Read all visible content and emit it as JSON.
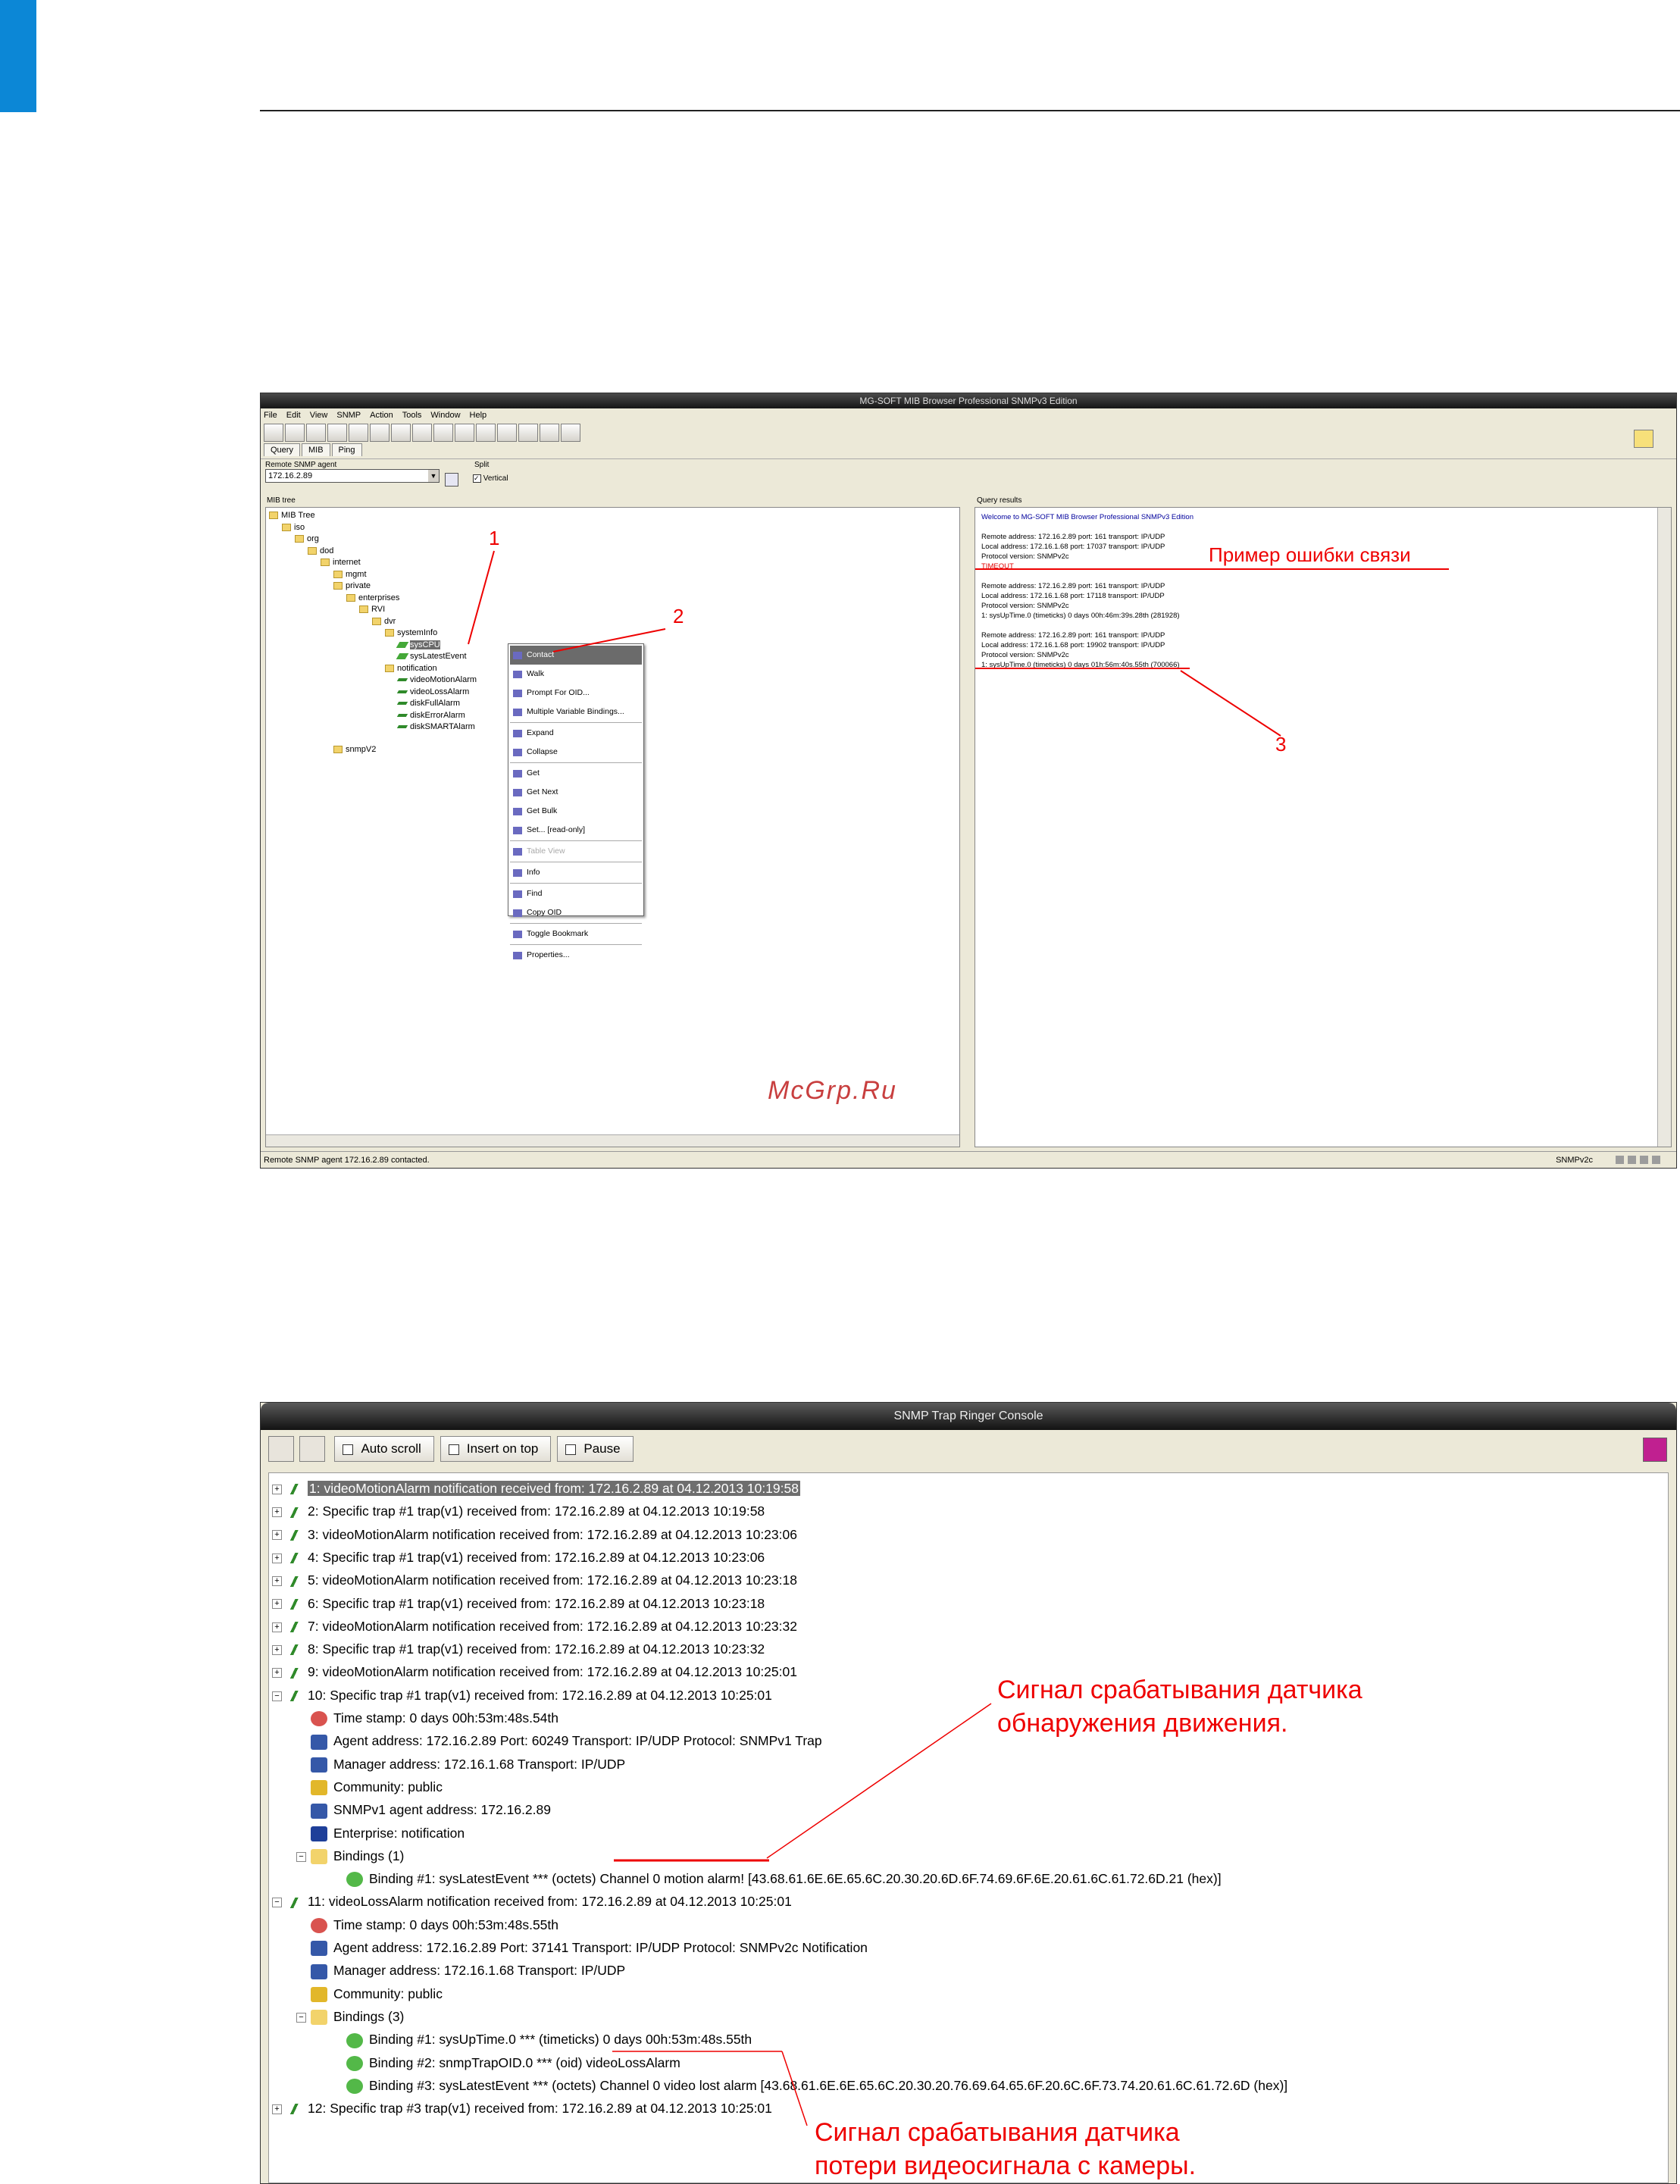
{
  "window1": {
    "title": "MG-SOFT MIB Browser Professional SNMPv3 Edition",
    "menu": [
      "File",
      "Edit",
      "View",
      "SNMP",
      "Action",
      "Tools",
      "Window",
      "Help"
    ],
    "tabs": [
      "Query",
      "MIB",
      "Ping"
    ],
    "agent_label": "Remote SNMP agent",
    "agent_value": "172.16.2.89",
    "split_label": "Split",
    "vertical_label": "Vertical",
    "mib_tree_label": "MIB tree",
    "query_results_label": "Query results",
    "tree": [
      {
        "text": "MIB Tree",
        "level": 0,
        "icon": "folder"
      },
      {
        "text": "iso",
        "level": 1,
        "icon": "folder"
      },
      {
        "text": "org",
        "level": 2,
        "icon": "folder"
      },
      {
        "text": "dod",
        "level": 3,
        "icon": "folder"
      },
      {
        "text": "internet",
        "level": 4,
        "icon": "folder"
      },
      {
        "text": "mgmt",
        "level": 5,
        "icon": "folder"
      },
      {
        "text": "private",
        "level": 5,
        "icon": "folder"
      },
      {
        "text": "enterprises",
        "level": 6,
        "icon": "folder"
      },
      {
        "text": "RVI",
        "level": 7,
        "icon": "folder"
      },
      {
        "text": "dvr",
        "level": 8,
        "icon": "folder"
      },
      {
        "text": "systemInfo",
        "level": 9,
        "icon": "folder"
      },
      {
        "text": "sysCPU",
        "level": 10,
        "icon": "leaf",
        "selected": true
      },
      {
        "text": "sysLatestEvent",
        "level": 10,
        "icon": "leaf"
      },
      {
        "text": "notification",
        "level": 9,
        "icon": "folder"
      },
      {
        "text": "videoMotionAlarm",
        "level": 10,
        "icon": "trap"
      },
      {
        "text": "videoLossAlarm",
        "level": 10,
        "icon": "trap"
      },
      {
        "text": "diskFullAlarm",
        "level": 10,
        "icon": "trap"
      },
      {
        "text": "diskErrorAlarm",
        "level": 10,
        "icon": "trap"
      },
      {
        "text": "diskSMARTAlarm",
        "level": 10,
        "icon": "trap"
      },
      {
        "text": "snmpV2",
        "level": 5,
        "icon": "folder"
      }
    ],
    "context_menu": [
      {
        "label": "Contact",
        "highlight": true
      },
      {
        "label": "Walk"
      },
      {
        "label": "Prompt For OID..."
      },
      {
        "label": "Multiple Variable Bindings..."
      },
      {
        "sep": true
      },
      {
        "label": "Expand"
      },
      {
        "label": "Collapse"
      },
      {
        "sep": true
      },
      {
        "label": "Get"
      },
      {
        "label": "Get Next"
      },
      {
        "label": "Get Bulk"
      },
      {
        "label": "Set... [read-only]"
      },
      {
        "sep": true
      },
      {
        "label": "Table View",
        "disabled": true
      },
      {
        "sep": true
      },
      {
        "label": "Info"
      },
      {
        "sep": true
      },
      {
        "label": "Find"
      },
      {
        "label": "Copy OID"
      },
      {
        "sep": true
      },
      {
        "label": "Toggle Bookmark"
      },
      {
        "sep": true
      },
      {
        "label": "Properties..."
      }
    ],
    "query_results": [
      {
        "text": "Welcome to MG-SOFT MIB Browser Professional SNMPv3 Edition",
        "style": "blue"
      },
      {
        "text": "",
        "style": ""
      },
      {
        "text": "Remote address: 172.16.2.89  port: 161 transport: IP/UDP",
        "style": ""
      },
      {
        "text": "Local address: 172.16.1.68  port: 17037 transport: IP/UDP",
        "style": ""
      },
      {
        "text": "Protocol version: SNMPv2c",
        "style": ""
      },
      {
        "text": "TIMEOUT",
        "style": "red"
      },
      {
        "text": "",
        "style": ""
      },
      {
        "text": "Remote address: 172.16.2.89  port: 161 transport: IP/UDP",
        "style": ""
      },
      {
        "text": "Local address: 172.16.1.68  port: 17118 transport: IP/UDP",
        "style": ""
      },
      {
        "text": "Protocol version: SNMPv2c",
        "style": ""
      },
      {
        "text": "1: sysUpTime.0 (timeticks) 0 days 00h:46m:39s.28th (281928)",
        "style": ""
      },
      {
        "text": "",
        "style": ""
      },
      {
        "text": "Remote address: 172.16.2.89  port: 161 transport: IP/UDP",
        "style": ""
      },
      {
        "text": "Local address: 172.16.1.68  port: 19902 transport: IP/UDP",
        "style": ""
      },
      {
        "text": "Protocol version: SNMPv2c",
        "style": ""
      },
      {
        "text": "1: sysUpTime.0 (timeticks) 0 days 01h:56m:40s.55th (700066)",
        "style": ""
      }
    ],
    "status_left": "Remote SNMP agent 172.16.2.89 contacted.",
    "status_right": "SNMPv2c"
  },
  "annotations1": {
    "label1": "1",
    "label2": "2",
    "label3": "3",
    "error_example": "Пример ошибки связи",
    "watermark": "McGrp.Ru"
  },
  "window2": {
    "title": "SNMP Trap Ringer Console",
    "checkboxes": [
      "Auto scroll",
      "Insert on top",
      "Pause"
    ],
    "rows": [
      {
        "text": "1: videoMotionAlarm notification received from: 172.16.2.89 at 04.12.2013 10:19:58",
        "indent": 0,
        "icon": "trap",
        "pm": "+",
        "selected": true
      },
      {
        "text": "2: Specific trap #1 trap(v1) received from: 172.16.2.89 at 04.12.2013 10:19:58",
        "indent": 0,
        "icon": "trap",
        "pm": "+"
      },
      {
        "text": "3: videoMotionAlarm notification received from: 172.16.2.89 at 04.12.2013 10:23:06",
        "indent": 0,
        "icon": "trap",
        "pm": "+"
      },
      {
        "text": "4: Specific trap #1 trap(v1) received from: 172.16.2.89 at 04.12.2013 10:23:06",
        "indent": 0,
        "icon": "trap",
        "pm": "+"
      },
      {
        "text": "5: videoMotionAlarm notification received from: 172.16.2.89 at 04.12.2013 10:23:18",
        "indent": 0,
        "icon": "trap",
        "pm": "+"
      },
      {
        "text": "6: Specific trap #1 trap(v1) received from: 172.16.2.89 at 04.12.2013 10:23:18",
        "indent": 0,
        "icon": "trap",
        "pm": "+"
      },
      {
        "text": "7: videoMotionAlarm notification received from: 172.16.2.89 at 04.12.2013 10:23:32",
        "indent": 0,
        "icon": "trap",
        "pm": "+"
      },
      {
        "text": "8: Specific trap #1 trap(v1) received from: 172.16.2.89 at 04.12.2013 10:23:32",
        "indent": 0,
        "icon": "trap",
        "pm": "+"
      },
      {
        "text": "9: videoMotionAlarm notification received from: 172.16.2.89 at 04.12.2013 10:25:01",
        "indent": 0,
        "icon": "trap",
        "pm": "+"
      },
      {
        "text": "10: Specific trap #1 trap(v1) received from: 172.16.2.89 at 04.12.2013 10:25:01",
        "indent": 0,
        "icon": "trap",
        "pm": "-"
      },
      {
        "text": "Time stamp: 0 days 00h:53m:48s.54th",
        "indent": 1,
        "icon": "clock"
      },
      {
        "text": "Agent address: 172.16.2.89 Port: 60249 Transport: IP/UDP Protocol: SNMPv1 Trap",
        "indent": 1,
        "icon": "pc"
      },
      {
        "text": "Manager address: 172.16.1.68 Transport: IP/UDP",
        "indent": 1,
        "icon": "pc"
      },
      {
        "text": "Community: public",
        "indent": 1,
        "icon": "key"
      },
      {
        "text": "SNMPv1 agent address: 172.16.2.89",
        "indent": 1,
        "icon": "pc"
      },
      {
        "text": "Enterprise: notification",
        "indent": 1,
        "icon": "chart"
      },
      {
        "text": "Bindings (1)",
        "indent": 1,
        "icon": "folder",
        "pm": "-"
      },
      {
        "text": "Binding #1: sysLatestEvent *** (octets) Channel 0 motion alarm! [43.68.61.6E.6E.65.6C.20.30.20.6D.6F.74.69.6F.6E.20.61.6C.61.72.6D.21 (hex)]",
        "indent": 2,
        "icon": "leaf"
      },
      {
        "text": "11: videoLossAlarm notification received from: 172.16.2.89 at 04.12.2013 10:25:01",
        "indent": 0,
        "icon": "trap",
        "pm": "-"
      },
      {
        "text": "Time stamp: 0 days 00h:53m:48s.55th",
        "indent": 1,
        "icon": "clock"
      },
      {
        "text": "Agent address: 172.16.2.89 Port: 37141 Transport: IP/UDP Protocol: SNMPv2c Notification",
        "indent": 1,
        "icon": "pc"
      },
      {
        "text": "Manager address: 172.16.1.68 Transport: IP/UDP",
        "indent": 1,
        "icon": "pc"
      },
      {
        "text": "Community: public",
        "indent": 1,
        "icon": "key"
      },
      {
        "text": "Bindings (3)",
        "indent": 1,
        "icon": "folder",
        "pm": "-"
      },
      {
        "text": "Binding #1: sysUpTime.0 *** (timeticks) 0 days 00h:53m:48s.55th",
        "indent": 2,
        "icon": "leaf"
      },
      {
        "text": "Binding #2: snmpTrapOID.0 *** (oid) videoLossAlarm",
        "indent": 2,
        "icon": "leaf"
      },
      {
        "text": "Binding #3: sysLatestEvent *** (octets) Channel 0 video lost alarm [43.68.61.6E.6E.65.6C.20.30.20.76.69.64.65.6F.20.6C.6F.73.74.20.61.6C.61.72.6D (hex)]",
        "indent": 2,
        "icon": "leaf"
      },
      {
        "text": "12: Specific trap #3 trap(v1) received from: 172.16.2.89 at 04.12.2013 10:25:01",
        "indent": 0,
        "icon": "trap",
        "pm": "+"
      }
    ]
  },
  "annotations2": {
    "motion_line1": "Сигнал срабатывания датчика",
    "motion_line2": "обнаружения движения.",
    "video_line1": "Сигнал срабатывания датчика",
    "video_line2": "потери видеосигнала с камеры."
  }
}
